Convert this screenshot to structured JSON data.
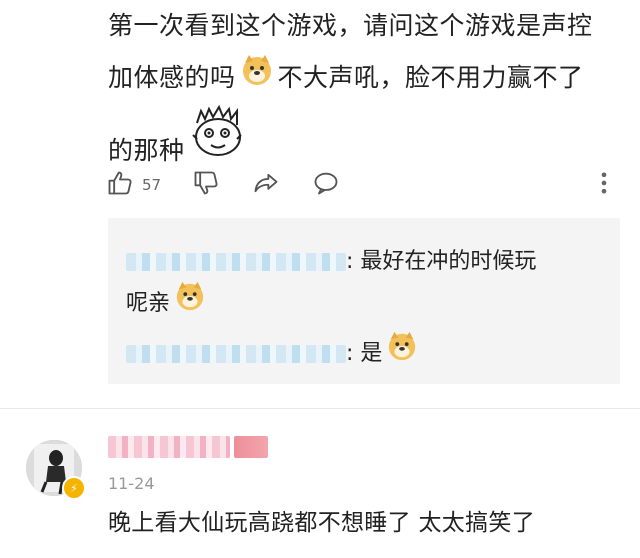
{
  "comment": {
    "line1": "第一次看到这个游戏，请问这个游戏是声控",
    "line2a": "加体感的吗",
    "line2b": "不大声吼，脸不用力赢不了",
    "line3": "的那种"
  },
  "actions": {
    "like_count": "57"
  },
  "replies": [
    {
      "text1": ": 最好在冲的时候玩",
      "text2": "呢亲"
    },
    {
      "text1": ": 是"
    }
  ],
  "next_comment": {
    "date": "11-24",
    "text": "晚上看大仙玩高跷都不想睡了 太太搞笑了"
  },
  "colors": {
    "accent_vip": "#f5b400",
    "reply_bg": "#f4f4f4"
  }
}
